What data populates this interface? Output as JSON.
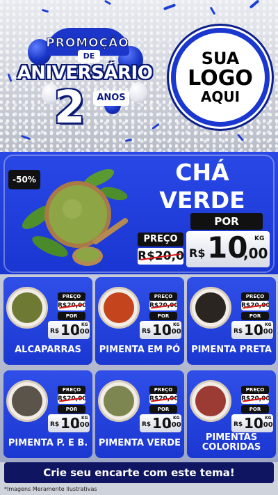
{
  "header": {
    "promo_arc": "PROMOÇÃO",
    "promo_de": "DE",
    "promo_title": "ANIVERSÁRIO",
    "promo_number": "2",
    "promo_anos": "ANOS",
    "logo_lines": [
      "SUA",
      "LOGO",
      "AQUI"
    ]
  },
  "featured": {
    "discount": "-50%",
    "title_line1": "CHÁ",
    "title_line2": "VERDE",
    "label_preco": "PREÇO",
    "label_por": "POR",
    "old_price": "R$20,00",
    "new_currency": "R$",
    "new_int": "10",
    "new_dec": ",00",
    "unit": "KG",
    "product_color": "#8ea546"
  },
  "products": [
    {
      "name": "ALCAPARRAS",
      "label_preco": "PREÇO",
      "old_price": "R$20,00",
      "label_por": "POR",
      "new_currency": "R$",
      "new_int": "10",
      "new_dec": ",00",
      "unit": "KG",
      "color": "#6e7a34"
    },
    {
      "name": "PIMENTA EM PÓ",
      "label_preco": "PREÇO",
      "old_price": "R$20,00",
      "label_por": "POR",
      "new_currency": "R$",
      "new_int": "10",
      "new_dec": ",00",
      "unit": "KG",
      "color": "#c4441d"
    },
    {
      "name": "PIMENTA PRETA",
      "label_preco": "PREÇO",
      "old_price": "R$20,00",
      "label_por": "POR",
      "new_currency": "R$",
      "new_int": "10",
      "new_dec": ",00",
      "unit": "KG",
      "color": "#2a2520"
    },
    {
      "name": "PIMENTA P. E B.",
      "label_preco": "PREÇO",
      "old_price": "R$20,00",
      "label_por": "POR",
      "new_currency": "R$",
      "new_int": "10",
      "new_dec": ",00",
      "unit": "KG",
      "color": "#5b544b"
    },
    {
      "name": "PIMENTA VERDE",
      "label_preco": "PREÇO",
      "old_price": "R$20,00",
      "label_por": "POR",
      "new_currency": "R$",
      "new_int": "10",
      "new_dec": ",00",
      "unit": "KG",
      "color": "#7d8650"
    },
    {
      "name": "PIMENTAS COLORIDAS",
      "label_preco": "PREÇO",
      "old_price": "R$20,00",
      "label_por": "POR",
      "new_currency": "R$",
      "new_int": "10",
      "new_dec": ",00",
      "unit": "KG",
      "color": "#9c3b34"
    }
  ],
  "footer": {
    "cta": "Crie seu encarte com este tema!",
    "disclaimer": "*Imagens Meramente Ilustrativas"
  },
  "colors": {
    "brand_blue": "#1b37d2",
    "dark_navy": "#0f1560",
    "strike_red": "#dd1111"
  }
}
